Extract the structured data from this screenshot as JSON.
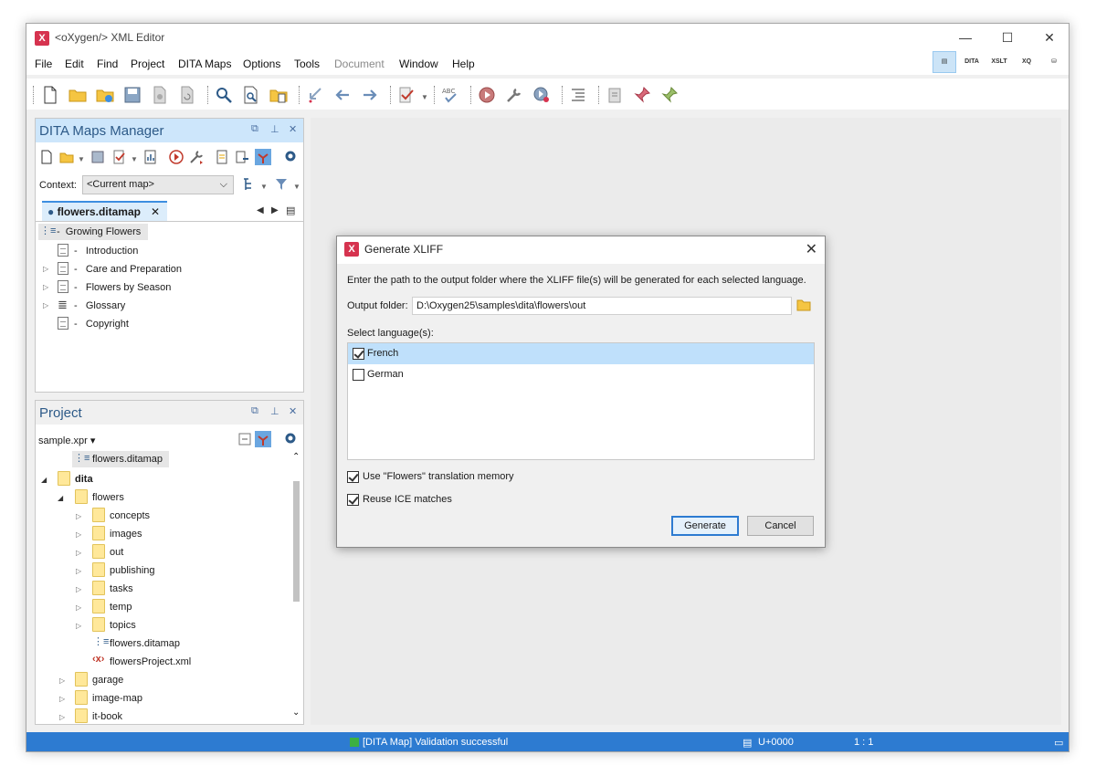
{
  "window": {
    "title": "<oXygen/> XML Editor",
    "minimize": "—",
    "maximize": "☐",
    "close": "✕"
  },
  "menu": [
    "File",
    "Edit",
    "Find",
    "Project",
    "DITA Maps",
    "Options",
    "Tools",
    "Document",
    "Window",
    "Help"
  ],
  "perspectives": [
    "Editor",
    "DITA",
    "XSLT",
    "XQ",
    "DB"
  ],
  "dita_maps_manager": {
    "title": "DITA Maps Manager",
    "context_label": "Context:",
    "context_value": "<Current map>",
    "tab_label": "flowers.ditamap",
    "root": "Growing Flowers",
    "topics": [
      "Introduction",
      "Care and Preparation",
      "Flowers by Season",
      "Glossary",
      "Copyright"
    ]
  },
  "project": {
    "title": "Project",
    "project_file": "sample.xpr",
    "items": {
      "top_file": "flowers.ditamap",
      "dita": "dita",
      "flowers": "flowers",
      "subfolders": [
        "concepts",
        "images",
        "out",
        "publishing",
        "tasks",
        "temp",
        "topics"
      ],
      "file1": "flowers.ditamap",
      "file2": "flowersProject.xml",
      "others": [
        "garage",
        "image-map",
        "it-book"
      ]
    }
  },
  "dialog": {
    "title": "Generate XLIFF",
    "description": "Enter the path to the output folder where the XLIFF file(s) will be generated for each selected language.",
    "output_label": "Output folder:",
    "output_value": "D:\\Oxygen25\\samples\\dita\\flowers\\out",
    "languages_label": "Select language(s):",
    "languages": [
      {
        "name": "French",
        "checked": true
      },
      {
        "name": "German",
        "checked": false
      }
    ],
    "use_memory": "Use \"Flowers\" translation memory",
    "reuse_ice": "Reuse ICE matches",
    "generate": "Generate",
    "cancel": "Cancel"
  },
  "status": {
    "message": "[DITA Map] Validation successful",
    "unicode": "U+0000",
    "position": "1 : 1"
  },
  "colors": {
    "accent": "#2d7bd1",
    "panel_header": "#cde6fb",
    "selection": "#bfe0fb",
    "status_ok": "#3cb043"
  }
}
